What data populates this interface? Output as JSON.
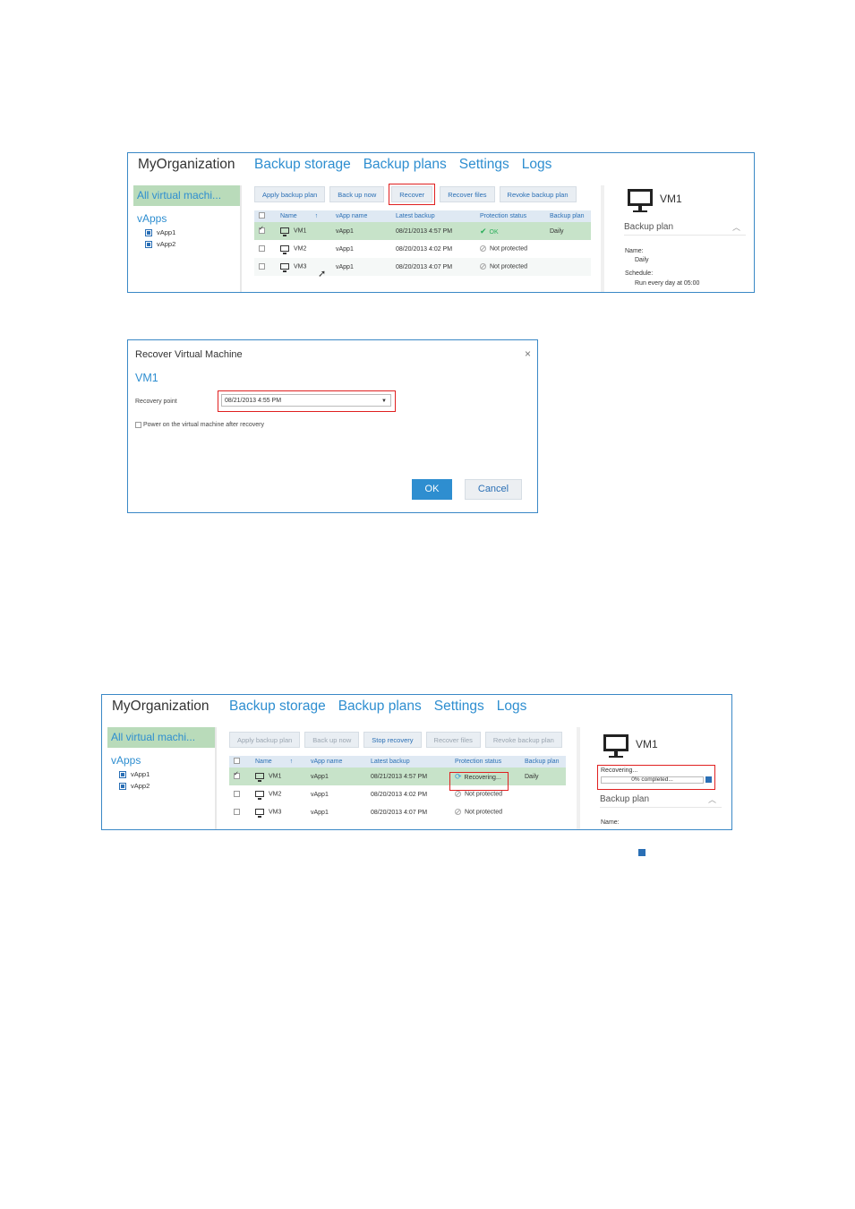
{
  "screen1": {
    "org": "MyOrganization",
    "nav": [
      "Backup storage",
      "Backup plans",
      "Settings",
      "Logs"
    ],
    "sidebar": {
      "all": "All virtual machi...",
      "vapps_heading": "vApps",
      "vapps": [
        "vApp1",
        "vApp2"
      ]
    },
    "toolbar": [
      "Apply backup plan",
      "Back up now",
      "Recover",
      "Recover files",
      "Revoke backup plan"
    ],
    "columns": [
      "Name",
      "vApp name",
      "Latest backup",
      "Protection status",
      "Backup plan"
    ],
    "rows": [
      {
        "name": "VM1",
        "vapp": "vApp1",
        "latest": "08/21/2013 4:57 PM",
        "status": "OK",
        "plan": "Daily",
        "checked": true
      },
      {
        "name": "VM2",
        "vapp": "vApp1",
        "latest": "08/20/2013 4:02 PM",
        "status": "Not protected",
        "plan": "",
        "checked": false
      },
      {
        "name": "VM3",
        "vapp": "vApp1",
        "latest": "08/20/2013 4:07 PM",
        "status": "Not protected",
        "plan": "",
        "checked": false
      }
    ],
    "details": {
      "vm": "VM1",
      "section": "Backup plan",
      "name_label": "Name:",
      "name_value": "Daily",
      "schedule_label": "Schedule:",
      "schedule_value": "Run every day at 05:00"
    }
  },
  "dialog": {
    "title": "Recover Virtual Machine",
    "close": "×",
    "vm": "VM1",
    "recovery_label": "Recovery point",
    "recovery_value": "08/21/2013 4:55 PM",
    "power_on_label": "Power on the virtual machine after recovery",
    "ok": "OK",
    "cancel": "Cancel"
  },
  "screen2": {
    "org": "MyOrganization",
    "nav": [
      "Backup storage",
      "Backup plans",
      "Settings",
      "Logs"
    ],
    "sidebar": {
      "all": "All virtual machi...",
      "vapps_heading": "vApps",
      "vapps": [
        "vApp1",
        "vApp2"
      ]
    },
    "toolbar": [
      "Apply backup plan",
      "Back up now",
      "Stop recovery",
      "Recover files",
      "Revoke backup plan"
    ],
    "columns": [
      "Name",
      "vApp name",
      "Latest backup",
      "Protection status",
      "Backup plan"
    ],
    "rows": [
      {
        "name": "VM1",
        "vapp": "vApp1",
        "latest": "08/21/2013 4:57 PM",
        "status": "Recovering...",
        "plan": "Daily",
        "checked": true
      },
      {
        "name": "VM2",
        "vapp": "vApp1",
        "latest": "08/20/2013 4:02 PM",
        "status": "Not protected",
        "plan": "",
        "checked": false
      },
      {
        "name": "VM3",
        "vapp": "vApp1",
        "latest": "08/20/2013 4:07 PM",
        "status": "Not protected",
        "plan": "",
        "checked": false
      }
    ],
    "details": {
      "vm": "VM1",
      "recovering_label": "Recovering...",
      "progress_text": "0% completed...",
      "progress_fraction": 0,
      "section": "Backup plan",
      "name_label": "Name:"
    }
  },
  "colors": {
    "accent": "#2e8ed0",
    "selected_row": "#c7e3c9",
    "highlight": "#e02020",
    "ok": "#2cae5b"
  }
}
